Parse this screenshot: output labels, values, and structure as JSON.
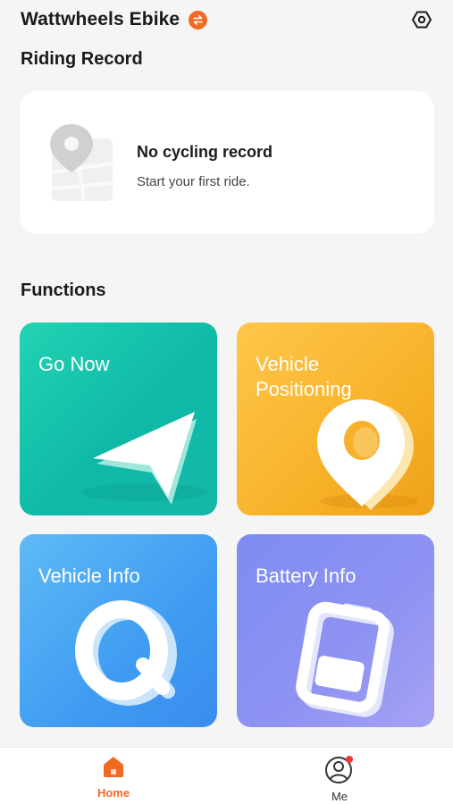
{
  "header": {
    "title": "Wattwheels Ebike",
    "switch_icon": "swap-icon",
    "settings_icon": "settings-hexagon-icon"
  },
  "riding_record": {
    "title": "Riding Record",
    "empty_title": "No cycling record",
    "empty_subtitle": "Start your first ride."
  },
  "functions": {
    "title": "Functions",
    "items": [
      {
        "label": "Go Now",
        "icon": "navigation-arrow-icon",
        "color": "#15c2ad"
      },
      {
        "label": "Vehicle Positioning",
        "icon": "location-pin-icon",
        "color": "#f7b22a"
      },
      {
        "label": "Vehicle Info",
        "icon": "magnifier-q-icon",
        "color": "#4aa6f3"
      },
      {
        "label": "Battery Info",
        "icon": "battery-icon",
        "color": "#8f93f2"
      }
    ]
  },
  "tabbar": {
    "items": [
      {
        "label": "Home",
        "icon": "home-icon",
        "active": true
      },
      {
        "label": "Me",
        "icon": "user-icon",
        "badge": true
      }
    ]
  },
  "colors": {
    "accent": "#f06a24",
    "background": "#f5f5f5",
    "badge": "#f0383a"
  }
}
